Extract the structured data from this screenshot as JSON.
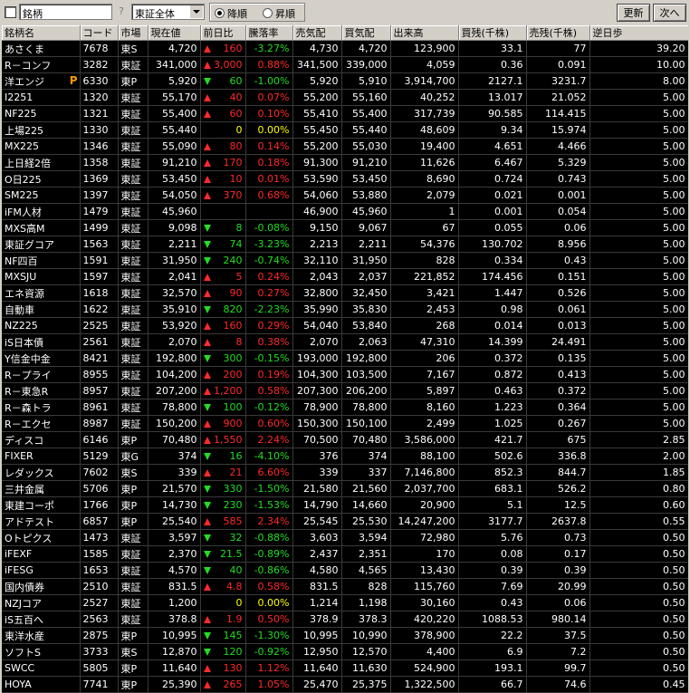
{
  "toolbar": {
    "field_label": "銘柄",
    "help_label": "?",
    "market_select": "東証全体",
    "sort_desc": "降順",
    "sort_asc": "昇順",
    "refresh_label": "更新",
    "next_label": "次へ"
  },
  "columns": [
    "銘柄名",
    "コード",
    "市場",
    "現在値",
    "前日比",
    "騰落率",
    "売気配",
    "買気配",
    "出来高",
    "買残(千株)",
    "売残(千株)",
    "逆日歩"
  ],
  "rows": [
    {
      "name": "あさくま",
      "code": "7678",
      "market": "東S",
      "price": "4,720",
      "dir": "up",
      "chg": "160",
      "pct": "-3.27%",
      "pd": "dn",
      "ask": "4,730",
      "bid": "4,720",
      "vol": "123,900",
      "buy": "33.1",
      "sell": "77",
      "rev": "39.20"
    },
    {
      "name": "R－コンフ",
      "code": "3282",
      "market": "東証",
      "price": "341,000",
      "dir": "up",
      "chg": "3,000",
      "pct": "0.88%",
      "pd": "up",
      "ask": "341,500",
      "bid": "339,000",
      "vol": "4,059",
      "buy": "0.36",
      "sell": "0.091",
      "rev": "10.00"
    },
    {
      "name": "洋エンジ",
      "badge": "P",
      "code": "6330",
      "market": "東P",
      "price": "5,920",
      "dir": "dn",
      "chg": "60",
      "pct": "-1.00%",
      "pd": "dn",
      "ask": "5,920",
      "bid": "5,910",
      "vol": "3,914,700",
      "buy": "2127.1",
      "sell": "3231.7",
      "rev": "8.00"
    },
    {
      "name": "I2251",
      "code": "1320",
      "market": "東証",
      "price": "55,170",
      "dir": "up",
      "chg": "40",
      "pct": "0.07%",
      "pd": "up",
      "ask": "55,200",
      "bid": "55,160",
      "vol": "40,252",
      "buy": "13.017",
      "sell": "21.052",
      "rev": "5.00"
    },
    {
      "name": "NF225",
      "code": "1321",
      "market": "東証",
      "price": "55,400",
      "dir": "up",
      "chg": "60",
      "pct": "0.10%",
      "pd": "up",
      "ask": "55,410",
      "bid": "55,400",
      "vol": "317,739",
      "buy": "90.585",
      "sell": "114.415",
      "rev": "5.00"
    },
    {
      "name": "上場225",
      "code": "1330",
      "market": "東証",
      "price": "55,440",
      "dir": "",
      "chg": "0",
      "pct": "0.00%",
      "pd": "fl",
      "ask": "55,450",
      "bid": "55,440",
      "vol": "48,609",
      "buy": "9.34",
      "sell": "15.974",
      "rev": "5.00"
    },
    {
      "name": "MX225",
      "code": "1346",
      "market": "東証",
      "price": "55,090",
      "dir": "up",
      "chg": "80",
      "pct": "0.14%",
      "pd": "up",
      "ask": "55,200",
      "bid": "55,030",
      "vol": "19,400",
      "buy": "4.651",
      "sell": "4.466",
      "rev": "5.00"
    },
    {
      "name": "上日経2倍",
      "code": "1358",
      "market": "東証",
      "price": "91,210",
      "dir": "up",
      "chg": "170",
      "pct": "0.18%",
      "pd": "up",
      "ask": "91,300",
      "bid": "91,210",
      "vol": "11,626",
      "buy": "6.467",
      "sell": "5.329",
      "rev": "5.00"
    },
    {
      "name": "O日225",
      "code": "1369",
      "market": "東証",
      "price": "53,450",
      "dir": "up",
      "chg": "10",
      "pct": "0.01%",
      "pd": "up",
      "ask": "53,590",
      "bid": "53,450",
      "vol": "8,690",
      "buy": "0.724",
      "sell": "0.743",
      "rev": "5.00"
    },
    {
      "name": "SM225",
      "code": "1397",
      "market": "東証",
      "price": "54,050",
      "dir": "up",
      "chg": "370",
      "pct": "0.68%",
      "pd": "up",
      "ask": "54,060",
      "bid": "53,880",
      "vol": "2,079",
      "buy": "0.021",
      "sell": "0.001",
      "rev": "5.00"
    },
    {
      "name": "iFM人材",
      "code": "1479",
      "market": "東証",
      "price": "45,960",
      "dir": "",
      "chg": "",
      "pct": "",
      "pd": "",
      "ask": "46,900",
      "bid": "45,960",
      "vol": "1",
      "buy": "0.001",
      "sell": "0.054",
      "rev": "5.00"
    },
    {
      "name": "MXS高M",
      "code": "1499",
      "market": "東証",
      "price": "9,098",
      "dir": "dn",
      "chg": "8",
      "pct": "-0.08%",
      "pd": "dn",
      "ask": "9,150",
      "bid": "9,067",
      "vol": "67",
      "buy": "0.055",
      "sell": "0.06",
      "rev": "5.00"
    },
    {
      "name": "東証グコア",
      "code": "1563",
      "market": "東証",
      "price": "2,211",
      "dir": "dn",
      "chg": "74",
      "pct": "-3.23%",
      "pd": "dn",
      "ask": "2,213",
      "bid": "2,211",
      "vol": "54,376",
      "buy": "130.702",
      "sell": "8.956",
      "rev": "5.00"
    },
    {
      "name": "NF四百",
      "code": "1591",
      "market": "東証",
      "price": "31,950",
      "dir": "dn",
      "chg": "240",
      "pct": "-0.74%",
      "pd": "dn",
      "ask": "32,110",
      "bid": "31,950",
      "vol": "828",
      "buy": "0.334",
      "sell": "0.43",
      "rev": "5.00"
    },
    {
      "name": "MXSJU",
      "code": "1597",
      "market": "東証",
      "price": "2,041",
      "dir": "up",
      "chg": "5",
      "pct": "0.24%",
      "pd": "up",
      "ask": "2,043",
      "bid": "2,037",
      "vol": "221,852",
      "buy": "174.456",
      "sell": "0.151",
      "rev": "5.00"
    },
    {
      "name": "エネ資源",
      "code": "1618",
      "market": "東証",
      "price": "32,570",
      "dir": "up",
      "chg": "90",
      "pct": "0.27%",
      "pd": "up",
      "ask": "32,800",
      "bid": "32,450",
      "vol": "3,421",
      "buy": "1.447",
      "sell": "0.526",
      "rev": "5.00"
    },
    {
      "name": "自動車",
      "code": "1622",
      "market": "東証",
      "price": "35,910",
      "dir": "dn",
      "chg": "820",
      "pct": "-2.23%",
      "pd": "dn",
      "ask": "35,990",
      "bid": "35,830",
      "vol": "2,453",
      "buy": "0.98",
      "sell": "0.061",
      "rev": "5.00"
    },
    {
      "name": "NZ225",
      "code": "2525",
      "market": "東証",
      "price": "53,920",
      "dir": "up",
      "chg": "160",
      "pct": "0.29%",
      "pd": "up",
      "ask": "54,040",
      "bid": "53,840",
      "vol": "268",
      "buy": "0.014",
      "sell": "0.013",
      "rev": "5.00"
    },
    {
      "name": "iS日本債",
      "code": "2561",
      "market": "東証",
      "price": "2,070",
      "dir": "up",
      "chg": "8",
      "pct": "0.38%",
      "pd": "up",
      "ask": "2,070",
      "bid": "2,063",
      "vol": "47,310",
      "buy": "14.399",
      "sell": "24.491",
      "rev": "5.00"
    },
    {
      "name": "Y信金中金",
      "code": "8421",
      "market": "東証",
      "price": "192,800",
      "dir": "dn",
      "chg": "300",
      "pct": "-0.15%",
      "pd": "dn",
      "ask": "193,000",
      "bid": "192,800",
      "vol": "206",
      "buy": "0.372",
      "sell": "0.135",
      "rev": "5.00"
    },
    {
      "name": "R－プライ",
      "code": "8955",
      "market": "東証",
      "price": "104,200",
      "dir": "up",
      "chg": "200",
      "pct": "0.19%",
      "pd": "up",
      "ask": "104,300",
      "bid": "103,500",
      "vol": "7,167",
      "buy": "0.872",
      "sell": "0.413",
      "rev": "5.00"
    },
    {
      "name": "R－東急R",
      "code": "8957",
      "market": "東証",
      "price": "207,200",
      "dir": "up",
      "chg": "1,200",
      "pct": "0.58%",
      "pd": "up",
      "ask": "207,300",
      "bid": "206,200",
      "vol": "5,897",
      "buy": "0.463",
      "sell": "0.372",
      "rev": "5.00"
    },
    {
      "name": "R－森トラ",
      "code": "8961",
      "market": "東証",
      "price": "78,800",
      "dir": "dn",
      "chg": "100",
      "pct": "-0.12%",
      "pd": "dn",
      "ask": "78,900",
      "bid": "78,800",
      "vol": "8,160",
      "buy": "1.223",
      "sell": "0.364",
      "rev": "5.00"
    },
    {
      "name": "R－エクセ",
      "code": "8987",
      "market": "東証",
      "price": "150,200",
      "dir": "up",
      "chg": "900",
      "pct": "0.60%",
      "pd": "up",
      "ask": "150,300",
      "bid": "150,100",
      "vol": "2,499",
      "buy": "1.025",
      "sell": "0.267",
      "rev": "5.00"
    },
    {
      "name": "ディスコ",
      "code": "6146",
      "market": "東P",
      "price": "70,480",
      "dir": "up",
      "chg": "1,550",
      "pct": "2.24%",
      "pd": "up",
      "ask": "70,500",
      "bid": "70,480",
      "vol": "3,586,000",
      "buy": "421.7",
      "sell": "675",
      "rev": "2.85"
    },
    {
      "name": "FIXER",
      "code": "5129",
      "market": "東G",
      "price": "374",
      "dir": "dn",
      "chg": "16",
      "pct": "-4.10%",
      "pd": "dn",
      "ask": "376",
      "bid": "374",
      "vol": "88,100",
      "buy": "502.6",
      "sell": "336.8",
      "rev": "2.00"
    },
    {
      "name": "レダックス",
      "code": "7602",
      "market": "東S",
      "price": "339",
      "dir": "up",
      "chg": "21",
      "pct": "6.60%",
      "pd": "up",
      "ask": "339",
      "bid": "337",
      "vol": "7,146,800",
      "buy": "852.3",
      "sell": "844.7",
      "rev": "1.85"
    },
    {
      "name": "三井金属",
      "code": "5706",
      "market": "東P",
      "price": "21,570",
      "dir": "dn",
      "chg": "330",
      "pct": "-1.50%",
      "pd": "dn",
      "ask": "21,580",
      "bid": "21,560",
      "vol": "2,037,700",
      "buy": "683.1",
      "sell": "526.2",
      "rev": "0.80"
    },
    {
      "name": "東建コーポ",
      "code": "1766",
      "market": "東P",
      "price": "14,730",
      "dir": "dn",
      "chg": "230",
      "pct": "-1.53%",
      "pd": "dn",
      "ask": "14,790",
      "bid": "14,660",
      "vol": "20,900",
      "buy": "5.1",
      "sell": "12.5",
      "rev": "0.60"
    },
    {
      "name": "アドテスト",
      "code": "6857",
      "market": "東P",
      "price": "25,540",
      "dir": "up",
      "chg": "585",
      "pct": "2.34%",
      "pd": "up",
      "ask": "25,545",
      "bid": "25,530",
      "vol": "14,247,200",
      "buy": "3177.7",
      "sell": "2637.8",
      "rev": "0.55"
    },
    {
      "name": "Oトピクス",
      "code": "1473",
      "market": "東証",
      "price": "3,597",
      "dir": "dn",
      "chg": "32",
      "pct": "-0.88%",
      "pd": "dn",
      "ask": "3,603",
      "bid": "3,594",
      "vol": "72,980",
      "buy": "5.76",
      "sell": "0.73",
      "rev": "0.50"
    },
    {
      "name": "iFEXF",
      "code": "1585",
      "market": "東証",
      "price": "2,370",
      "dir": "dn",
      "chg": "21.5",
      "pct": "-0.89%",
      "pd": "dn",
      "ask": "2,437",
      "bid": "2,351",
      "vol": "170",
      "buy": "0.08",
      "sell": "0.17",
      "rev": "0.50"
    },
    {
      "name": "iFESG",
      "code": "1653",
      "market": "東証",
      "price": "4,570",
      "dir": "dn",
      "chg": "40",
      "pct": "-0.86%",
      "pd": "dn",
      "ask": "4,580",
      "bid": "4,565",
      "vol": "13,430",
      "buy": "0.39",
      "sell": "0.39",
      "rev": "0.50"
    },
    {
      "name": "国内債券",
      "code": "2510",
      "market": "東証",
      "price": "831.5",
      "dir": "up",
      "chg": "4.8",
      "pct": "0.58%",
      "pd": "up",
      "ask": "831.5",
      "bid": "828",
      "vol": "115,760",
      "buy": "7.69",
      "sell": "20.99",
      "rev": "0.50"
    },
    {
      "name": "NZJコア",
      "code": "2527",
      "market": "東証",
      "price": "1,200",
      "dir": "",
      "chg": "0",
      "pct": "0.00%",
      "pd": "fl",
      "ask": "1,214",
      "bid": "1,198",
      "vol": "30,160",
      "buy": "0.43",
      "sell": "0.06",
      "rev": "0.50"
    },
    {
      "name": "iS五百へ",
      "code": "2563",
      "market": "東証",
      "price": "378.8",
      "dir": "up",
      "chg": "1.9",
      "pct": "0.50%",
      "pd": "up",
      "ask": "378.9",
      "bid": "378.3",
      "vol": "420,220",
      "buy": "1088.53",
      "sell": "980.14",
      "rev": "0.50"
    },
    {
      "name": "東洋水産",
      "code": "2875",
      "market": "東P",
      "price": "10,995",
      "dir": "dn",
      "chg": "145",
      "pct": "-1.30%",
      "pd": "dn",
      "ask": "10,995",
      "bid": "10,990",
      "vol": "378,900",
      "buy": "22.2",
      "sell": "37.5",
      "rev": "0.50"
    },
    {
      "name": "ソフトS",
      "code": "3733",
      "market": "東S",
      "price": "12,870",
      "dir": "dn",
      "chg": "120",
      "pct": "-0.92%",
      "pd": "dn",
      "ask": "12,950",
      "bid": "12,570",
      "vol": "4,400",
      "buy": "6.9",
      "sell": "7.2",
      "rev": "0.50"
    },
    {
      "name": "SWCC",
      "code": "5805",
      "market": "東P",
      "price": "11,640",
      "dir": "up",
      "chg": "130",
      "pct": "1.12%",
      "pd": "up",
      "ask": "11,640",
      "bid": "11,630",
      "vol": "524,900",
      "buy": "193.1",
      "sell": "99.7",
      "rev": "0.50"
    },
    {
      "name": "HOYA",
      "code": "7741",
      "market": "東P",
      "price": "25,390",
      "dir": "up",
      "chg": "265",
      "pct": "1.05%",
      "pd": "up",
      "ask": "25,470",
      "bid": "25,375",
      "vol": "1,322,500",
      "buy": "66.7",
      "sell": "74.6",
      "rev": "0.45"
    }
  ]
}
